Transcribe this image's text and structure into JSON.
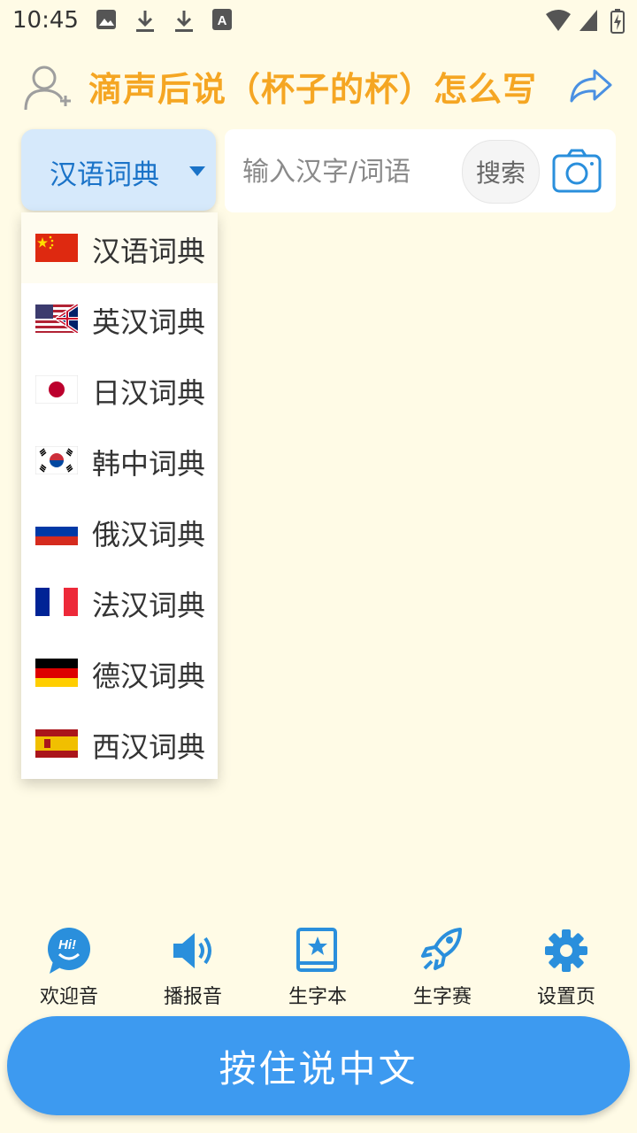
{
  "status": {
    "time": "10:45",
    "icons": [
      "image-icon",
      "download-icon",
      "download-icon",
      "font-icon",
      "wifi-icon",
      "signal-icon",
      "battery-charging-icon"
    ]
  },
  "header": {
    "title": "滴声后说（杯子的杯）怎么写",
    "title_color": "#f5a623"
  },
  "search": {
    "dictionary_selected": "汉语词典",
    "placeholder": "输入汉字/词语",
    "button_label": "搜索"
  },
  "dropdown": {
    "items": [
      {
        "label": "汉语词典",
        "flag": "china-flag-icon"
      },
      {
        "label": "英汉词典",
        "flag": "usa-uk-flag-icon"
      },
      {
        "label": "日汉词典",
        "flag": "japan-flag-icon"
      },
      {
        "label": "韩中词典",
        "flag": "korea-flag-icon"
      },
      {
        "label": "俄汉词典",
        "flag": "russia-flag-icon"
      },
      {
        "label": "法汉词典",
        "flag": "france-flag-icon"
      },
      {
        "label": "德汉词典",
        "flag": "germany-flag-icon"
      },
      {
        "label": "西汉词典",
        "flag": "spain-flag-icon"
      }
    ]
  },
  "toolbar": {
    "items": [
      {
        "label": "欢迎音",
        "icon": "hi-bubble-icon"
      },
      {
        "label": "播报音",
        "icon": "speaker-icon"
      },
      {
        "label": "生字本",
        "icon": "book-star-icon"
      },
      {
        "label": "生字赛",
        "icon": "rocket-icon"
      },
      {
        "label": "设置页",
        "icon": "gear-icon"
      }
    ]
  },
  "speak_button": {
    "label": "按住说中文"
  },
  "colors": {
    "accent": "#3d9af0",
    "background": "#fffbe6",
    "select_bg": "#d6e9fb"
  }
}
